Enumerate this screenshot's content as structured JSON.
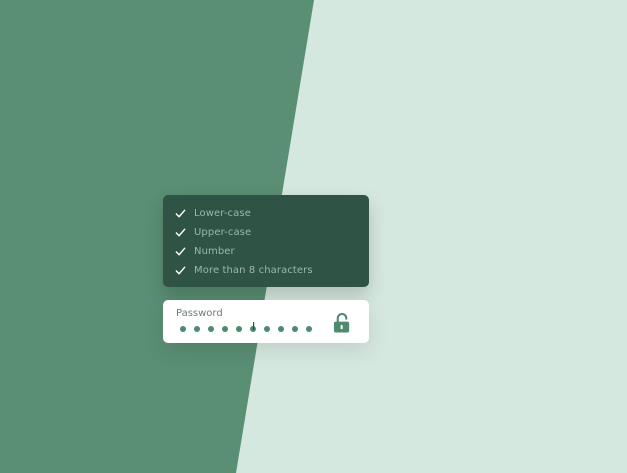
{
  "colors": {
    "left_panel": "#5a8f74",
    "right_panel": "#d5e8df",
    "checklist_bg": "#2f5446",
    "accent": "#4f8a6e"
  },
  "requirements": [
    {
      "label": "Lower-case",
      "met": true
    },
    {
      "label": "Upper-case",
      "met": true
    },
    {
      "label": "Number",
      "met": true
    },
    {
      "label": "More than 8 characters",
      "met": true
    }
  ],
  "password": {
    "label": "Password",
    "masked_length": 10,
    "lock_state": "unlocked",
    "lock_icon": "lock-open-icon"
  }
}
